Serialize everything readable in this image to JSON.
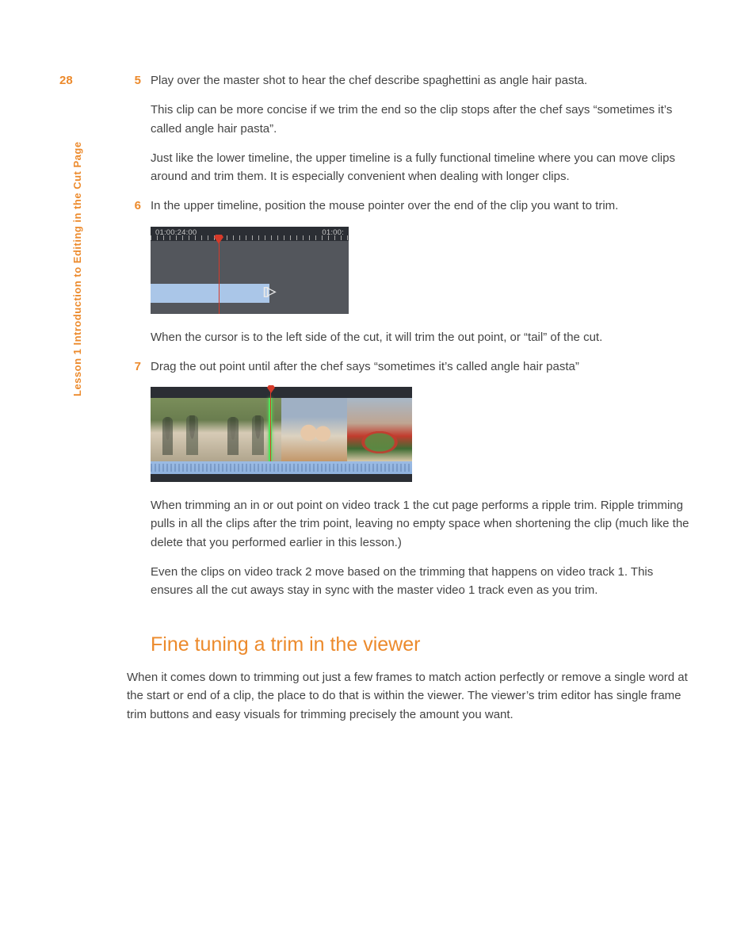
{
  "page_number": "28",
  "side_label": "Lesson 1    Introduction to Editing in the Cut Page",
  "steps": {
    "s5_num": "5",
    "s5_p1": "Play over the master shot to hear the chef describe spaghettini as angle hair pasta.",
    "s5_p2": "This clip can be more concise if we trim the end so the clip stops after the chef says “sometimes it’s called angle hair pasta”.",
    "s5_p3": "Just like the lower timeline, the upper timeline is a fully functional timeline where you can move clips around and trim them. It is especially convenient when dealing with longer clips.",
    "s6_num": "6",
    "s6_p1": "In the upper timeline, position the mouse pointer over the end of the clip you want to trim.",
    "s6_after": "When the cursor is to the left side of the cut, it will trim the out point, or “tail” of the cut.",
    "s7_num": "7",
    "s7_p1": "Drag the out point until after the chef says “sometimes it’s called angle hair pasta”",
    "s7_after1": "When trimming an in or out point on video track 1 the cut page performs a ripple trim. Ripple trimming pulls in all the clips after the trim point, leaving no empty space when shortening the clip (much like the delete that you performed earlier in this lesson.)",
    "s7_after2": "Even the clips on video track 2 move based on the trimming that happens on video track 1. This ensures all the cut aways stay in sync with the master video 1 track even as you trim."
  },
  "timeline_fig": {
    "tc_left": "01:00:24:00",
    "tc_right": "01:00:",
    "trim_cursor": "[]▷"
  },
  "section_heading": "Fine tuning a trim in the viewer",
  "section_body": "When it comes down to trimming out just a few frames to match action perfectly or remove a single word at the start or end of a clip, the place to do that is within the viewer. The viewer’s trim editor has single frame trim buttons and easy visuals for trimming precisely the amount you want."
}
